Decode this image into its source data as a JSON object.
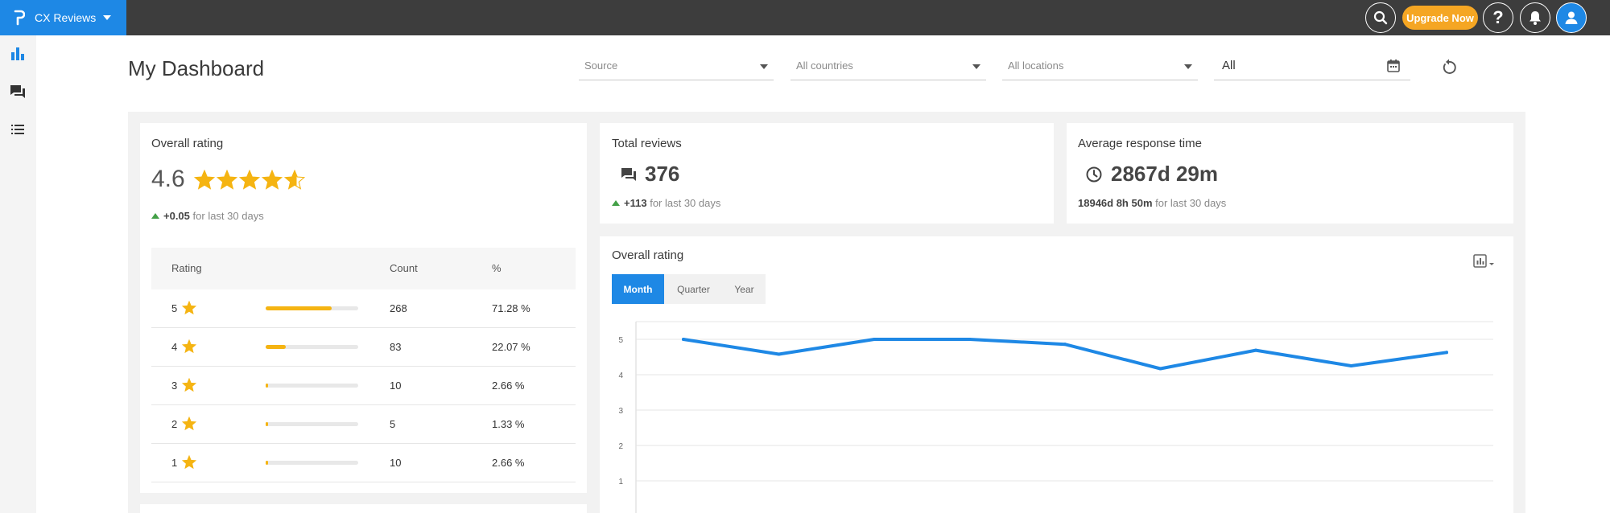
{
  "app": {
    "name": "CX Reviews"
  },
  "topbar": {
    "upgrade_label": "Upgrade Now",
    "help_glyph": "?"
  },
  "icons": {
    "search": "search-icon",
    "help": "help-icon",
    "notifications": "bell-icon",
    "account": "user-icon",
    "calendar": "calendar-icon",
    "reset": "reset-icon"
  },
  "colors": {
    "brand": "#1e88e5",
    "upgrade": "#f5a623",
    "star": "#f5b412",
    "positive": "#43a047",
    "topbar": "#3d3d3d"
  },
  "header": {
    "title": "My Dashboard",
    "filters": {
      "source": "Source",
      "countries": "All countries",
      "locations": "All locations",
      "date": "All"
    }
  },
  "overall_rating": {
    "title": "Overall rating",
    "value": "4.6",
    "stars": 4.6,
    "delta": "+0.05",
    "delta_suffix": "for last 30 days",
    "table": {
      "headers": {
        "rating": "Rating",
        "count": "Count",
        "percent": "%"
      },
      "rows": [
        {
          "rating": "5",
          "count": "268",
          "percent": "71.28 %",
          "share": 0.7128
        },
        {
          "rating": "4",
          "count": "83",
          "percent": "22.07 %",
          "share": 0.2207
        },
        {
          "rating": "3",
          "count": "10",
          "percent": "2.66 %",
          "share": 0.0266
        },
        {
          "rating": "2",
          "count": "5",
          "percent": "1.33 %",
          "share": 0.0133
        },
        {
          "rating": "1",
          "count": "10",
          "percent": "2.66 %",
          "share": 0.0266
        }
      ]
    }
  },
  "total_reviews": {
    "title": "Total reviews",
    "value": "376",
    "delta": "+113",
    "delta_suffix": "for last 30 days"
  },
  "avg_response": {
    "title": "Average response time",
    "value": "2867d 29m",
    "sub_value": "18946d 8h 50m",
    "sub_suffix": "for last 30 days"
  },
  "rating_chart": {
    "title": "Overall rating",
    "tabs": [
      {
        "label": "Month",
        "active": true
      },
      {
        "label": "Quarter",
        "active": false
      },
      {
        "label": "Year",
        "active": false
      }
    ]
  },
  "chart_data": {
    "type": "line",
    "title": "",
    "xlabel": "",
    "ylabel": "",
    "ylim": [
      0,
      5.5
    ],
    "yticks": [
      "1",
      "2",
      "3",
      "4",
      "5"
    ],
    "grid": true,
    "series": [
      {
        "values": [
          5.0,
          4.58,
          5.0,
          5.0,
          4.86,
          4.17,
          4.69,
          4.25,
          4.63
        ]
      }
    ]
  }
}
